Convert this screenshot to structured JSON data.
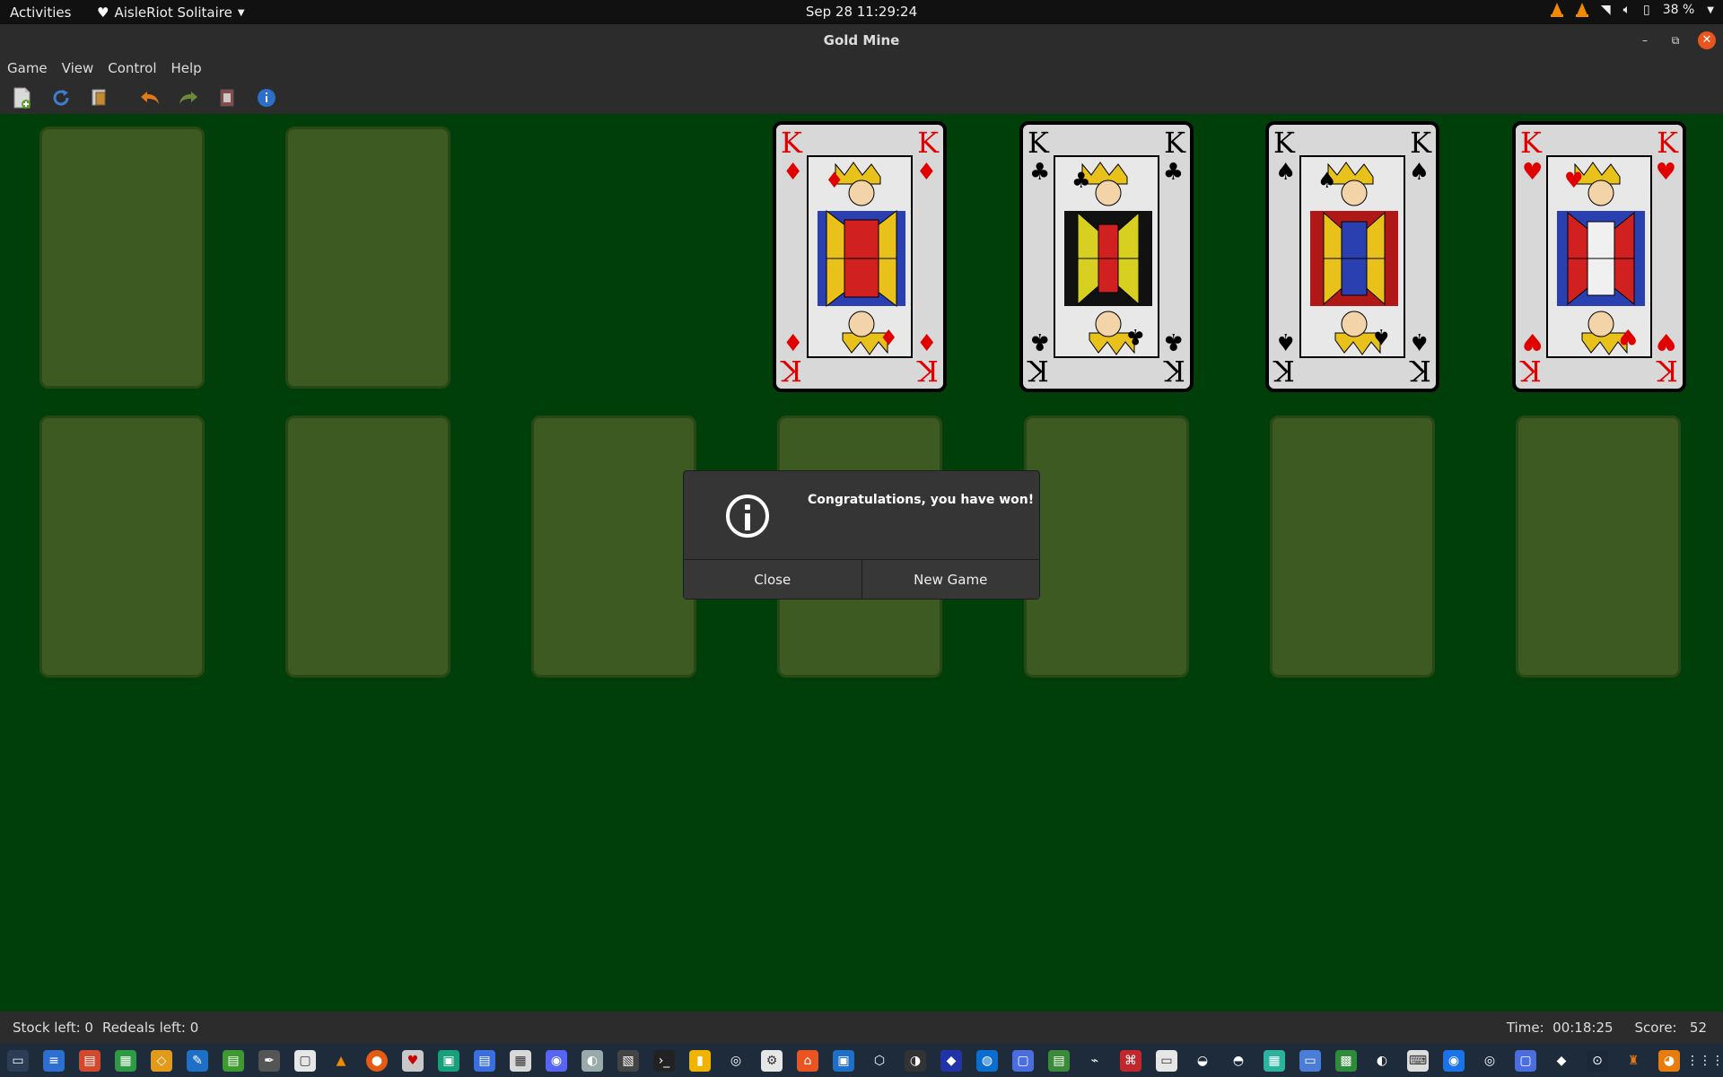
{
  "top_panel": {
    "activities": "Activities",
    "app_name": "AisleRiot Solitaire",
    "clock": "Sep 28  11:29:24",
    "battery": "38 %"
  },
  "window": {
    "title": "Gold Mine"
  },
  "menubar": [
    "Game",
    "View",
    "Control",
    "Help"
  ],
  "toolbar": {
    "icons": [
      "new-game-icon",
      "restart-icon",
      "select-game-icon",
      "undo-icon",
      "redo-icon",
      "hint-icon",
      "deal-icon"
    ]
  },
  "foundations": [
    {
      "rank": "K",
      "suit": "♦",
      "color": "red"
    },
    {
      "rank": "K",
      "suit": "♣",
      "color": "black"
    },
    {
      "rank": "K",
      "suit": "♠",
      "color": "black"
    },
    {
      "rank": "K",
      "suit": "♥",
      "color": "red"
    }
  ],
  "dialog": {
    "message": "Congratulations, you have won!",
    "close_label": "Close",
    "new_game_label": "New Game"
  },
  "statusbar": {
    "stock_left": "Stock left: 0",
    "redeals_left": "Redeals left: 0",
    "time": "Time:  00:18:25",
    "score": "Score:   52"
  },
  "colors": {
    "felt": "#003f0a",
    "slot": "#3d5a23",
    "accent_close": "#e9541f"
  }
}
